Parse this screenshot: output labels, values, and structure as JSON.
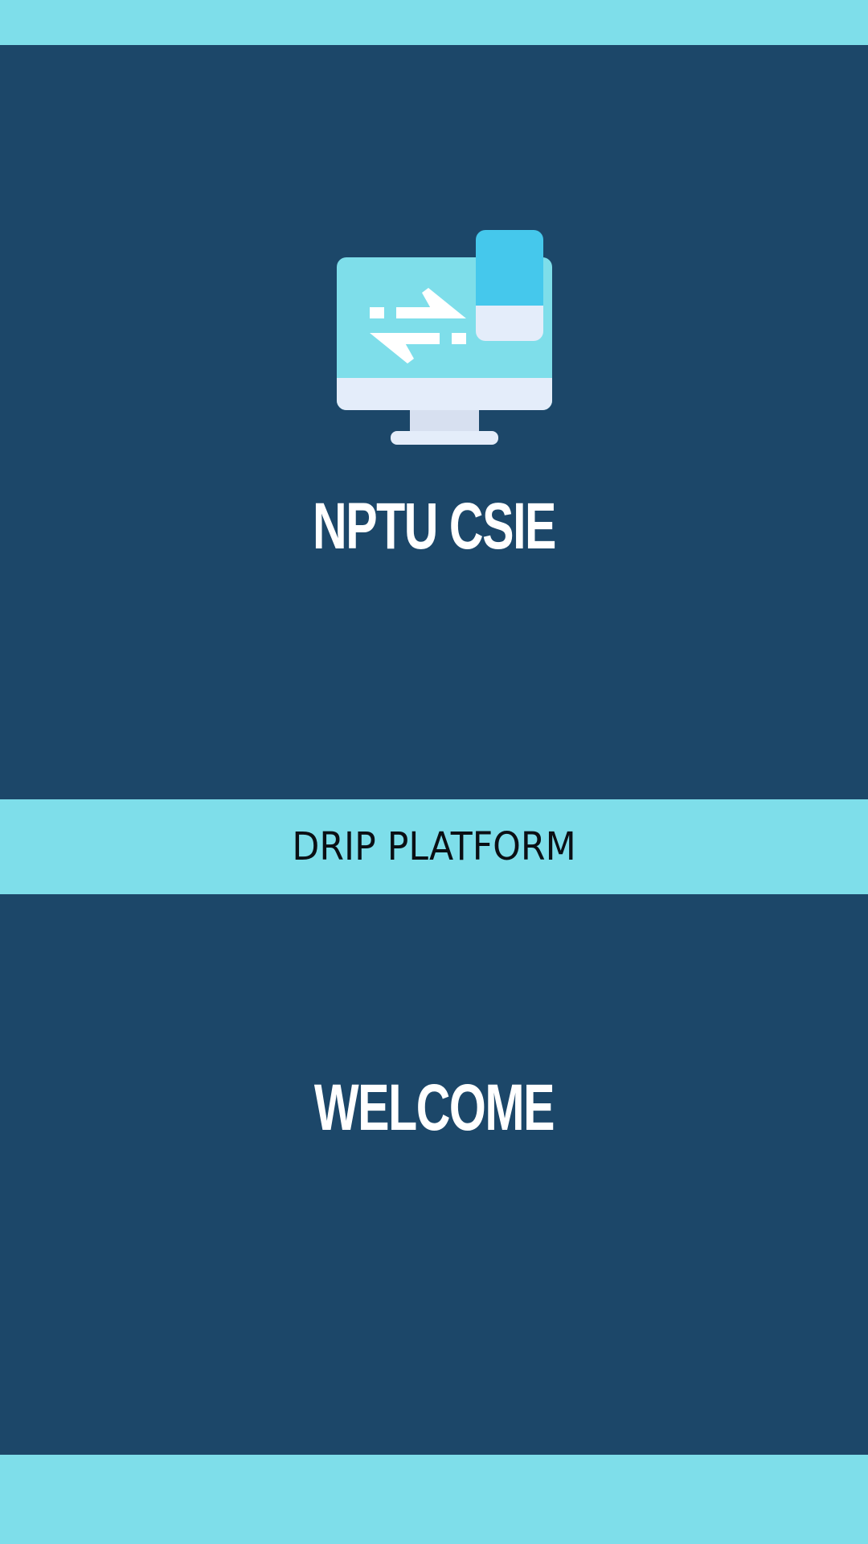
{
  "header": {
    "org_title": "NPTU CSIE"
  },
  "logo": {
    "icon": "computer-transfer-icon"
  },
  "banner": {
    "label": "DRIP PLATFORM"
  },
  "main": {
    "welcome_text": "WELCOME"
  },
  "colors": {
    "background": "#1c4769",
    "accent": "#7edeea",
    "text_light": "#ffffff",
    "text_dark": "#0a0f14"
  }
}
